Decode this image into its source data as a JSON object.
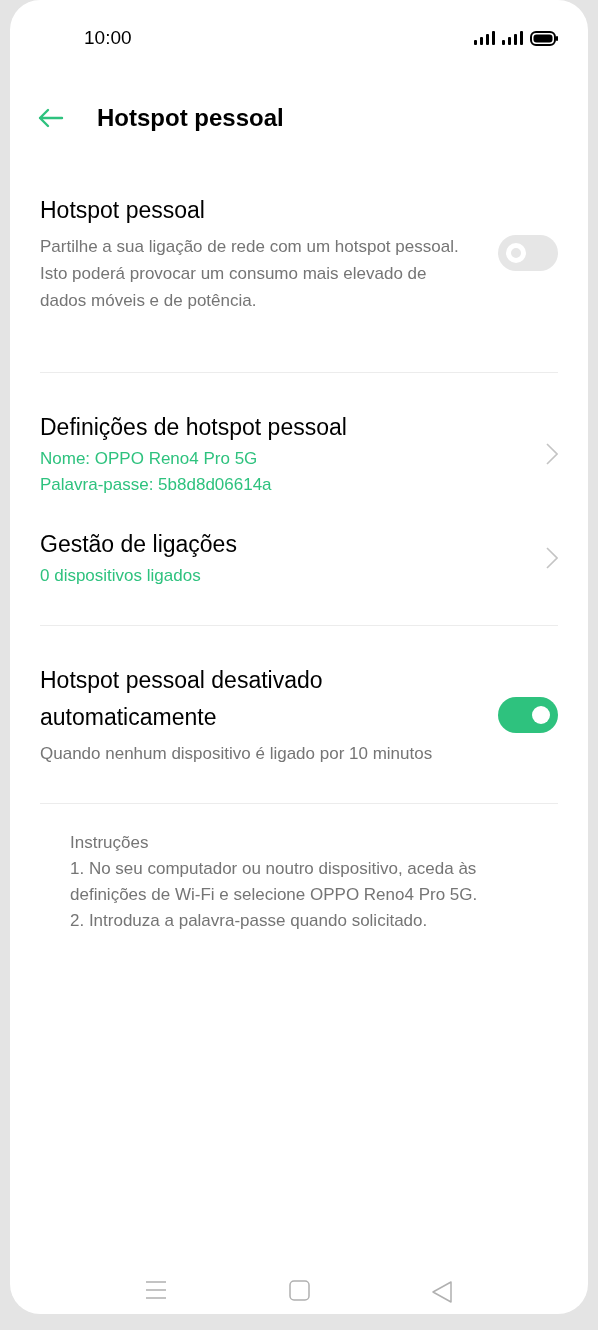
{
  "status_bar": {
    "time": "10:00"
  },
  "header": {
    "title": "Hotspot pessoal"
  },
  "sections": [
    {
      "items": [
        {
          "kind": "toggle",
          "title": "Hotspot pessoal",
          "description": "Partilhe a sua ligação de rede com um hotspot pessoal. Isto poderá provocar um consumo mais elevado de dados móveis e de potência.",
          "on": false
        }
      ]
    },
    {
      "items": [
        {
          "kind": "link",
          "title": "Definições de hotspot pessoal",
          "details": [
            "Nome: OPPO Reno4 Pro 5G",
            "Palavra-passe: 5b8d8d06614a"
          ]
        },
        {
          "kind": "link",
          "title": "Gestão de ligações",
          "details": [
            "0 dispositivos ligados"
          ]
        }
      ]
    },
    {
      "items": [
        {
          "kind": "toggle",
          "title": "Hotspot pessoal desativado automaticamente",
          "description": "Quando nenhum dispositivo é ligado por 10 minutos",
          "on": true
        }
      ]
    }
  ],
  "instructions": [
    "Instruções",
    "1. No seu computador ou noutro dispositivo, aceda às definições de Wi-Fi e selecione OPPO Reno4 Pro 5G.",
    "2. Introduza a palavra-passe quando solicitado."
  ]
}
